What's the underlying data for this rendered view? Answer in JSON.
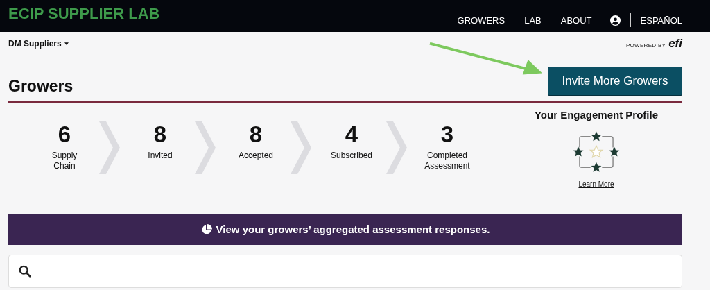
{
  "brand": "ECIP SUPPLIER LAB",
  "nav": [
    {
      "label": "GROWERS"
    },
    {
      "label": "LAB"
    },
    {
      "label": "ABOUT"
    }
  ],
  "language": "ESPAÑOL",
  "org_menu": "DM Suppliers",
  "powered_by": {
    "text": "POWERED BY",
    "logo": "efi"
  },
  "page_title": "Growers",
  "invite_button": "Invite More Growers",
  "stages": [
    {
      "value": "6",
      "label": "Supply Chain"
    },
    {
      "value": "8",
      "label": "Invited"
    },
    {
      "value": "8",
      "label": "Accepted"
    },
    {
      "value": "4",
      "label": "Subscribed"
    },
    {
      "value": "3",
      "label": "Completed Assessment"
    }
  ],
  "engagement": {
    "title": "Your Engagement Profile",
    "link": "Learn More"
  },
  "banner": "View your growers’ aggregated assessment responses."
}
